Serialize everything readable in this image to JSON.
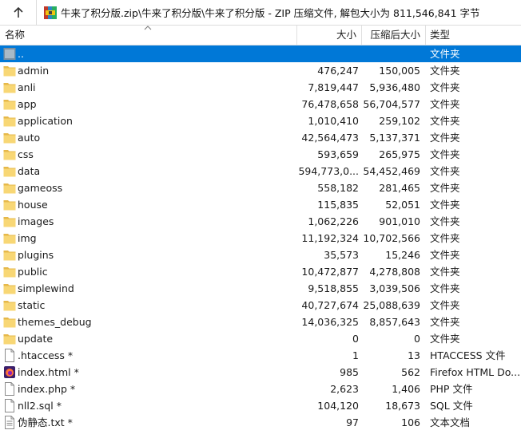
{
  "path": "牛来了积分版.zip\\牛来了积分版\\牛来了积分版 - ZIP 压缩文件, 解包大小为 811,546,841 字节",
  "columns": {
    "name": "名称",
    "size": "大小",
    "packed": "压缩后大小",
    "type": "类型"
  },
  "rows": [
    {
      "icon": "parent-folder-icon",
      "name": "..",
      "size": "",
      "packed": "",
      "type": "文件夹",
      "selected": true
    },
    {
      "icon": "folder-icon",
      "name": "admin",
      "size": "476,247",
      "packed": "150,005",
      "type": "文件夹"
    },
    {
      "icon": "folder-icon",
      "name": "anli",
      "size": "7,819,447",
      "packed": "5,936,480",
      "type": "文件夹"
    },
    {
      "icon": "folder-icon",
      "name": "app",
      "size": "76,478,658",
      "packed": "56,704,577",
      "type": "文件夹"
    },
    {
      "icon": "folder-icon",
      "name": "application",
      "size": "1,010,410",
      "packed": "259,102",
      "type": "文件夹"
    },
    {
      "icon": "folder-icon",
      "name": "auto",
      "size": "42,564,473",
      "packed": "5,137,371",
      "type": "文件夹"
    },
    {
      "icon": "folder-icon",
      "name": "css",
      "size": "593,659",
      "packed": "265,975",
      "type": "文件夹"
    },
    {
      "icon": "folder-icon",
      "name": "data",
      "size": "594,773,0...",
      "packed": "54,452,469",
      "type": "文件夹"
    },
    {
      "icon": "folder-icon",
      "name": "gameoss",
      "size": "558,182",
      "packed": "281,465",
      "type": "文件夹"
    },
    {
      "icon": "folder-icon",
      "name": "house",
      "size": "115,835",
      "packed": "52,051",
      "type": "文件夹"
    },
    {
      "icon": "folder-icon",
      "name": "images",
      "size": "1,062,226",
      "packed": "901,010",
      "type": "文件夹"
    },
    {
      "icon": "folder-icon",
      "name": "img",
      "size": "11,192,324",
      "packed": "10,702,566",
      "type": "文件夹"
    },
    {
      "icon": "folder-icon",
      "name": "plugins",
      "size": "35,573",
      "packed": "15,246",
      "type": "文件夹"
    },
    {
      "icon": "folder-icon",
      "name": "public",
      "size": "10,472,877",
      "packed": "4,278,808",
      "type": "文件夹"
    },
    {
      "icon": "folder-icon",
      "name": "simplewind",
      "size": "9,518,855",
      "packed": "3,039,506",
      "type": "文件夹"
    },
    {
      "icon": "folder-icon",
      "name": "static",
      "size": "40,727,674",
      "packed": "25,088,639",
      "type": "文件夹"
    },
    {
      "icon": "folder-icon",
      "name": "themes_debug",
      "size": "14,036,325",
      "packed": "8,857,643",
      "type": "文件夹"
    },
    {
      "icon": "folder-icon",
      "name": "update",
      "size": "0",
      "packed": "0",
      "type": "文件夹"
    },
    {
      "icon": "file-icon",
      "name": ".htaccess *",
      "size": "1",
      "packed": "13",
      "type": "HTACCESS 文件"
    },
    {
      "icon": "firefox-html-icon",
      "name": "index.html *",
      "size": "985",
      "packed": "562",
      "type": "Firefox HTML Do..."
    },
    {
      "icon": "file-icon",
      "name": "index.php *",
      "size": "2,623",
      "packed": "1,406",
      "type": "PHP 文件"
    },
    {
      "icon": "file-icon",
      "name": "nll2.sql *",
      "size": "104,120",
      "packed": "18,673",
      "type": "SQL 文件"
    },
    {
      "icon": "text-file-icon",
      "name": "伪静态.txt *",
      "size": "97",
      "packed": "106",
      "type": "文本文档"
    }
  ],
  "colors": {
    "selection": "#0078d7",
    "folder": "#f8d775",
    "folder_dark": "#e6b84a"
  }
}
